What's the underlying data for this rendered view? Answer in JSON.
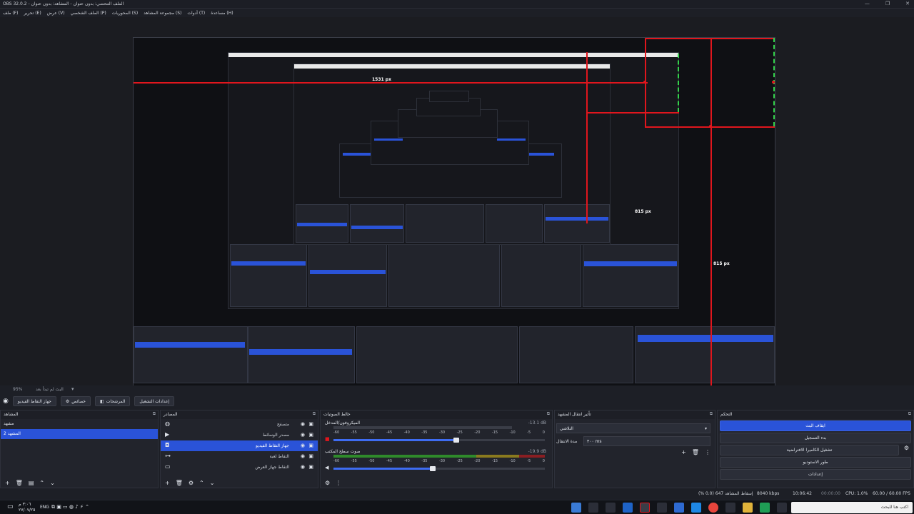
{
  "window": {
    "title": "الملف التنحضي: بدون عنوان - المشاهد: بدون عنوان - OBS 32.0.2",
    "minimize": "—",
    "maximize": "❐",
    "close": "✕"
  },
  "menu": [
    "ملف (F)",
    "تحرير (E)",
    "عرض (V)",
    "الملف الشخصي (P)",
    "المحوريات (S)",
    "مجموعة المشاهد (S)",
    "أدوات (T)",
    "مساعدة (H)"
  ],
  "preview": {
    "labels": [
      "1531 px",
      "815 px",
      "815 px"
    ],
    "red_color": "#e0161d",
    "green_color": "#33d14a",
    "accent": "#2a53d8"
  },
  "status_line": {
    "zoom": "95%",
    "scene_name": "البث لم تبدأ بعد"
  },
  "scene_toolbar": {
    "buttons": [
      "جهاز التقاط الفيديو",
      "خصائص",
      "المرشحات",
      "إعدادات التشغيل"
    ]
  },
  "scenes": {
    "title": "المشاهد",
    "items": [
      "مشهد",
      "المشهد 2"
    ],
    "selected": 1
  },
  "sources": {
    "title": "المصادر",
    "items": [
      {
        "label": "متصفح",
        "icon": "globe-icon"
      },
      {
        "label": "مصدر الوسائط",
        "icon": "play-icon"
      },
      {
        "label": "جهاز التقاط الفيديو",
        "icon": "camera-icon"
      },
      {
        "label": "التقاط لعبة",
        "icon": "gamepad-icon"
      },
      {
        "label": "التقاط جهاز العرض",
        "icon": "monitor-icon"
      }
    ],
    "selected": 2
  },
  "mixer": {
    "title": "خالط الصوتيات",
    "channels": [
      {
        "name": "الميكروفون/المدخل",
        "db": "-13.1 dB",
        "level": 0.58
      },
      {
        "name": "صوت سطح المكتب",
        "db": "-19.9 dB",
        "level": 0.47
      }
    ],
    "ticks": [
      "-60",
      "-55",
      "-50",
      "-45",
      "-40",
      "-35",
      "-30",
      "-25",
      "-20",
      "-15",
      "-10",
      "-5",
      "0"
    ]
  },
  "transitions": {
    "title": "تأثير انتقال المشهد",
    "type": "التلاشي",
    "duration_label": "مدة الانتقال",
    "duration_value": "٣٠٠ ms"
  },
  "controls": {
    "title": "التحكم",
    "buttons": [
      "ايقاف البث",
      "بدء التسجيل",
      "تشغيل الكاميرا الافتراضية",
      "طور الاستوديو",
      "إعدادات"
    ]
  },
  "statusbar": {
    "dropped": "إسقاط المشاهد 647 (0.0 %)",
    "bitrate": "8040 kbps",
    "stream_time": "10:06:42",
    "rec_time": "00:00:00",
    "cpu": "CPU: 1.0%",
    "fps": "60.00 / 60.00 FPS"
  },
  "taskbar": {
    "search_placeholder": "اكتب هنا للبحث",
    "time": "٣:٠٦ م",
    "date": "٢٧/٠٧/٢٥",
    "lang": "ENG"
  }
}
